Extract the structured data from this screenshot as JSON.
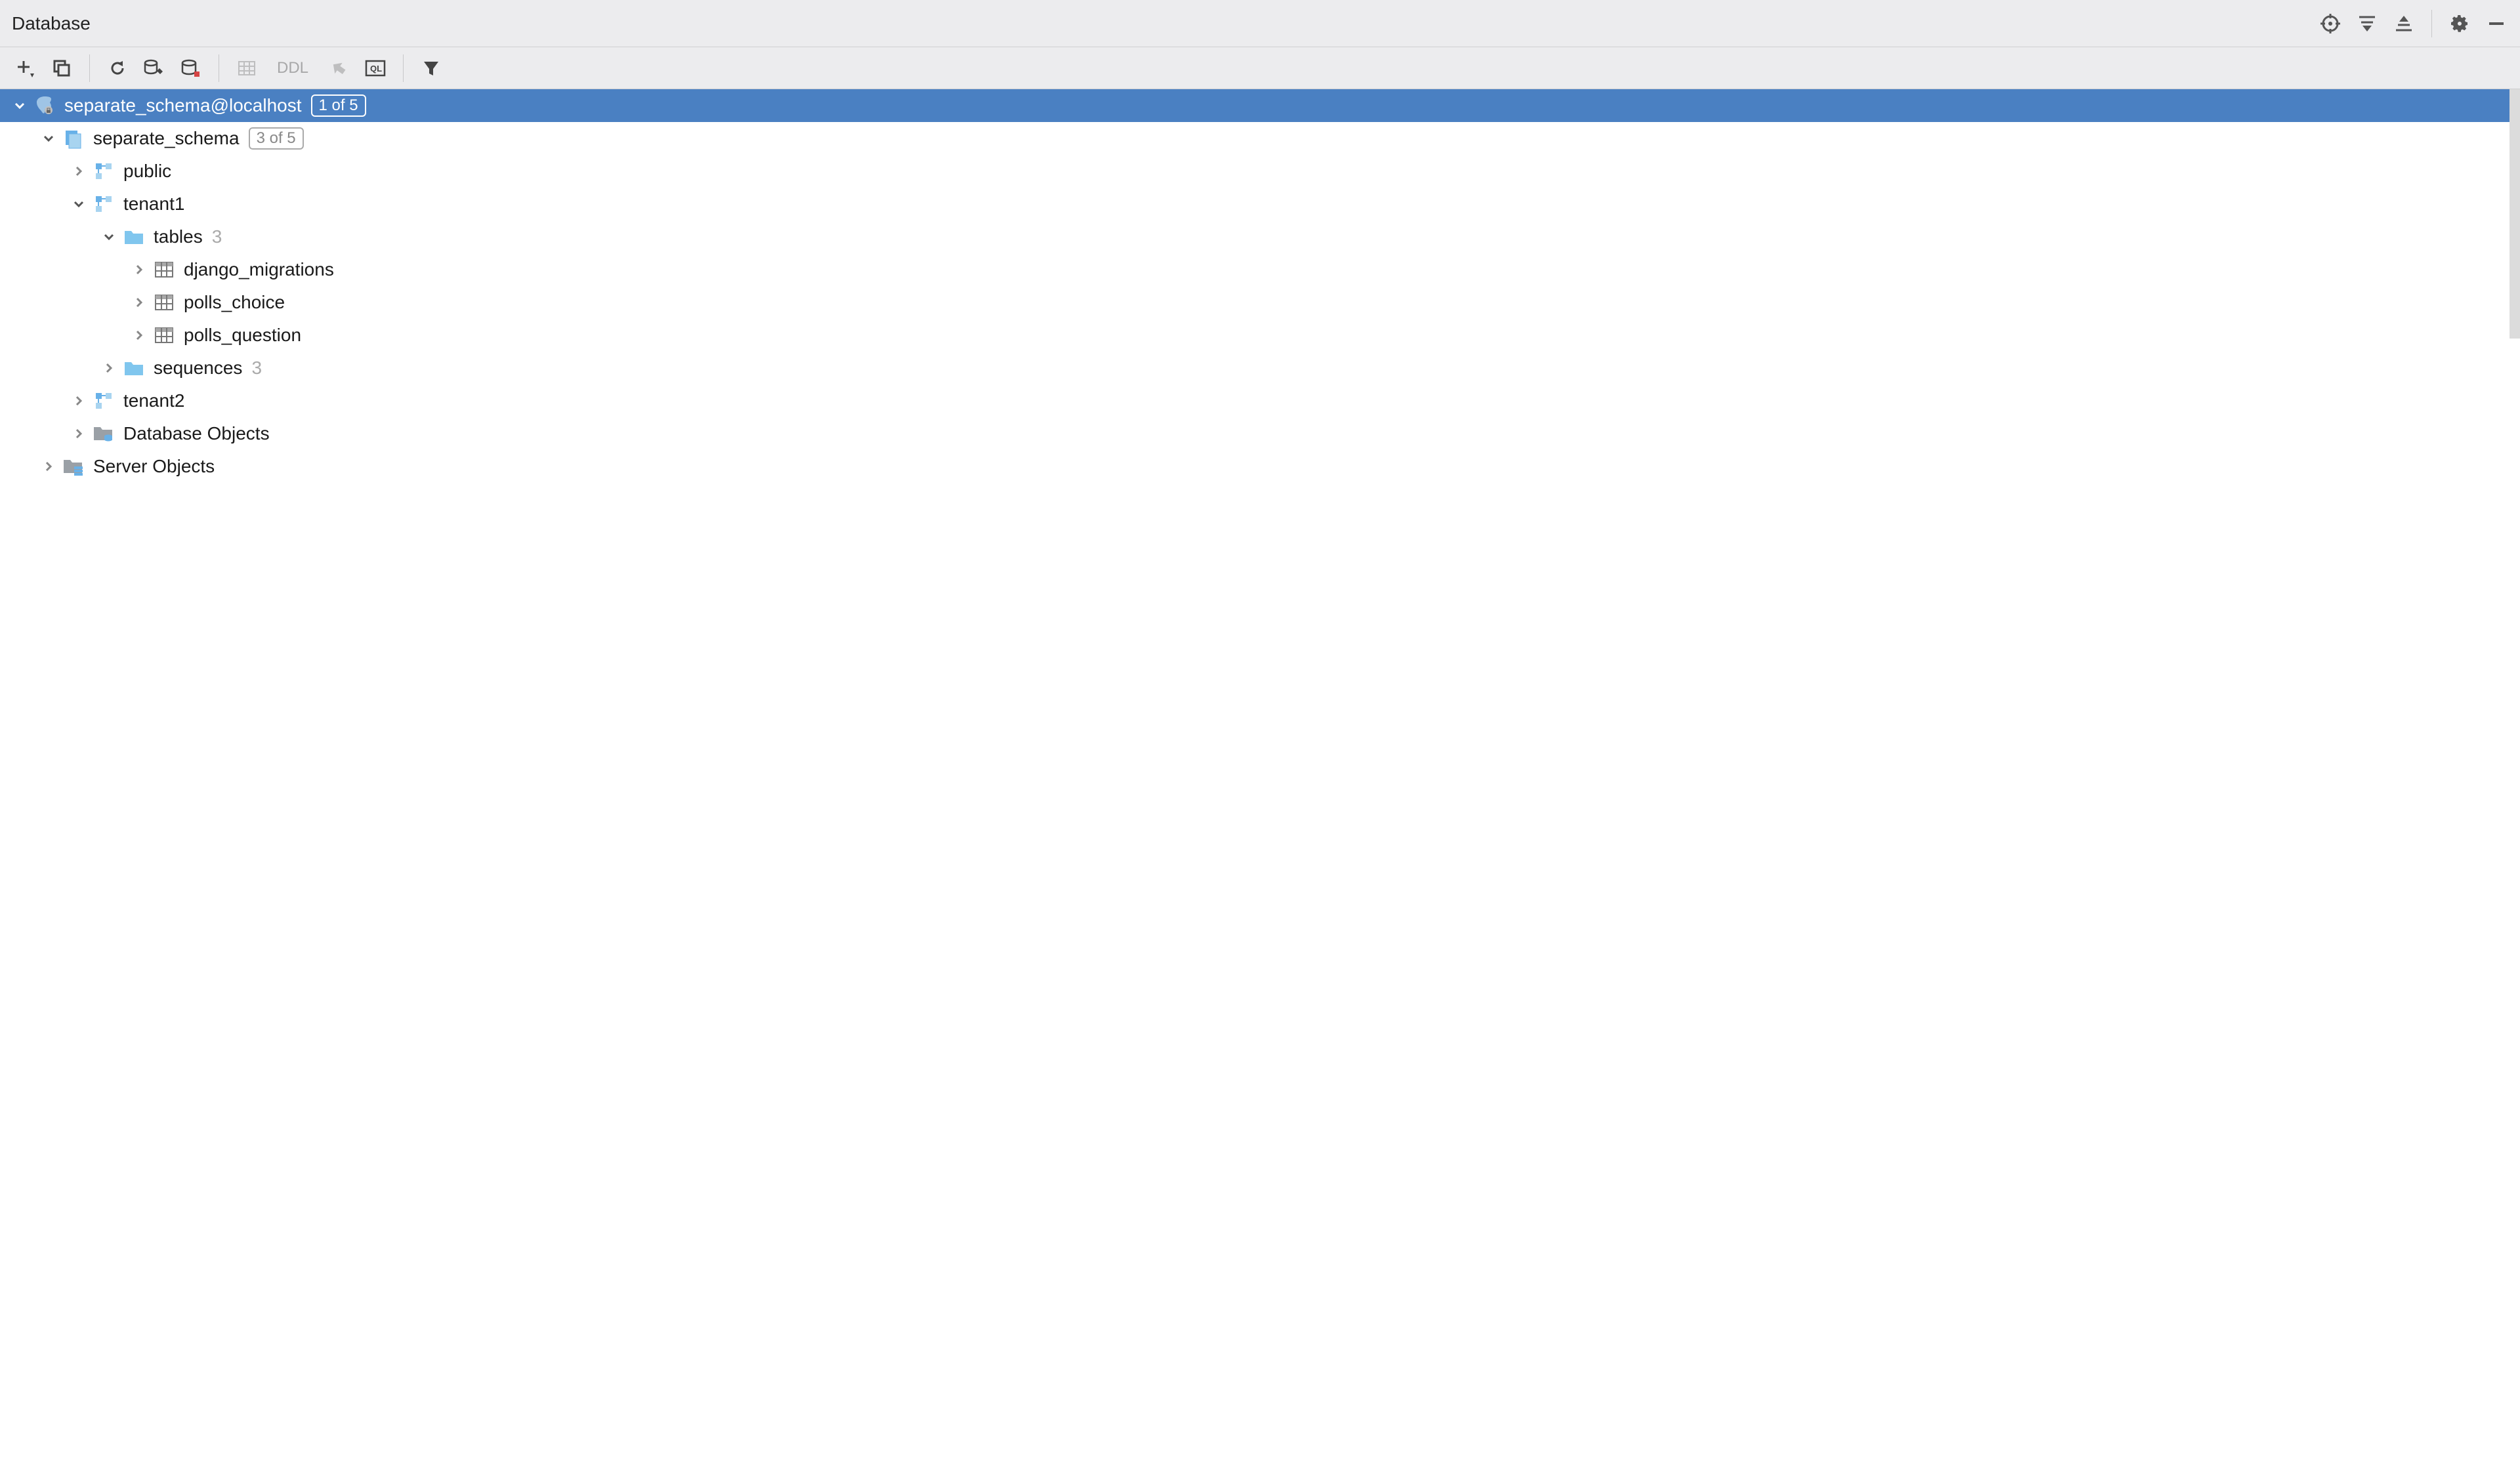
{
  "panel": {
    "title": "Database"
  },
  "toolbar": {
    "ddl_label": "DDL"
  },
  "tree": {
    "datasource": {
      "name": "separate_schema@localhost",
      "badge": "1 of 5"
    },
    "database": {
      "name": "separate_schema",
      "badge": "3 of 5"
    },
    "schemas": [
      {
        "name": "public"
      },
      {
        "name": "tenant1",
        "folders": {
          "tables": {
            "label": "tables",
            "count": "3",
            "items": [
              {
                "name": "django_migrations"
              },
              {
                "name": "polls_choice"
              },
              {
                "name": "polls_question"
              }
            ]
          },
          "sequences": {
            "label": "sequences",
            "count": "3"
          }
        }
      },
      {
        "name": "tenant2"
      }
    ],
    "database_objects": "Database Objects",
    "server_objects": "Server Objects"
  }
}
